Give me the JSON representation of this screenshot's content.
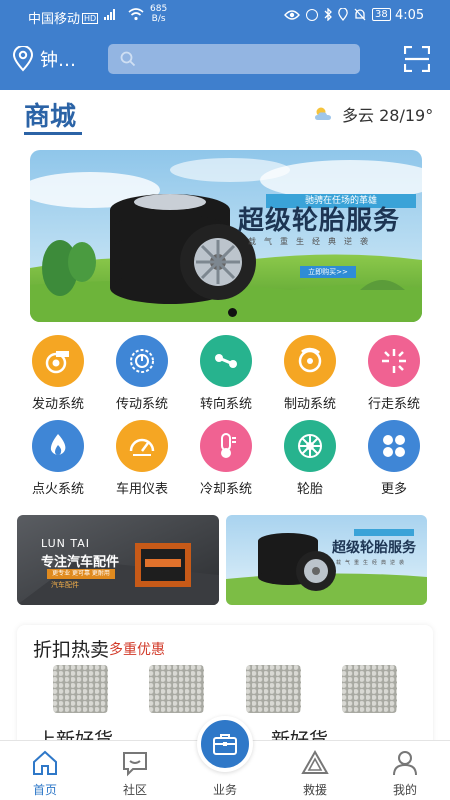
{
  "status_bar": {
    "carrier": "中国移动",
    "hd": "HD",
    "net": "4G",
    "speed_value": "685",
    "speed_unit": "B/s",
    "battery": "38",
    "time": "4:05"
  },
  "header": {
    "location": "钟…",
    "search_placeholder": ""
  },
  "mall": {
    "title": "商城",
    "weather_text": "多云 28/19°"
  },
  "banner": {
    "tag": "驰骋在任场的革雄",
    "title": "超级轮胎服务",
    "subtitle": "载气重生经典逆袭",
    "button": "立即购买>>",
    "active_index": 0
  },
  "categories": [
    {
      "label": "发动系统",
      "icon": "engine-icon",
      "color": "#f5a623"
    },
    {
      "label": "传动系统",
      "icon": "gear-icon",
      "color": "#3f86d6"
    },
    {
      "label": "转向系统",
      "icon": "steering-icon",
      "color": "#27b38e"
    },
    {
      "label": "制动系统",
      "icon": "brake-icon",
      "color": "#f5a623"
    },
    {
      "label": "行走系统",
      "icon": "chassis-icon",
      "color": "#f06292"
    },
    {
      "label": "点火系统",
      "icon": "flame-icon",
      "color": "#3f86d6"
    },
    {
      "label": "车用仪表",
      "icon": "gauge-icon",
      "color": "#f5a623"
    },
    {
      "label": "冷却系统",
      "icon": "thermometer-icon",
      "color": "#f06292"
    },
    {
      "label": "轮胎",
      "icon": "wheel-icon",
      "color": "#27b38e"
    },
    {
      "label": "更多",
      "icon": "more-icon",
      "color": "#3f86d6"
    }
  ],
  "promo_left": {
    "brand": "LUN TAI",
    "title": "专注汽车配件",
    "tag": "更专业 更可靠 更耐用",
    "caption": "汽车配件"
  },
  "promo_right": {
    "title": "超级轮胎服务",
    "subtitle": "载气重生经典逆袭"
  },
  "discount": {
    "title": "折扣热卖",
    "subtitle": "多重优惠",
    "new_left": "上新好货",
    "new_right": "新好货"
  },
  "bottom_nav": [
    {
      "label": "首页",
      "icon": "home-icon",
      "active": true
    },
    {
      "label": "社区",
      "icon": "chat-icon",
      "active": false
    },
    {
      "label": "业务",
      "icon": "briefcase-icon",
      "active": false
    },
    {
      "label": "救援",
      "icon": "warning-triangle-icon",
      "active": false
    },
    {
      "label": "我的",
      "icon": "user-icon",
      "active": false
    }
  ],
  "colors": {
    "primary": "#3f7fcd",
    "mall_title": "#2b63a6",
    "discount_accent": "#d23b2a"
  }
}
